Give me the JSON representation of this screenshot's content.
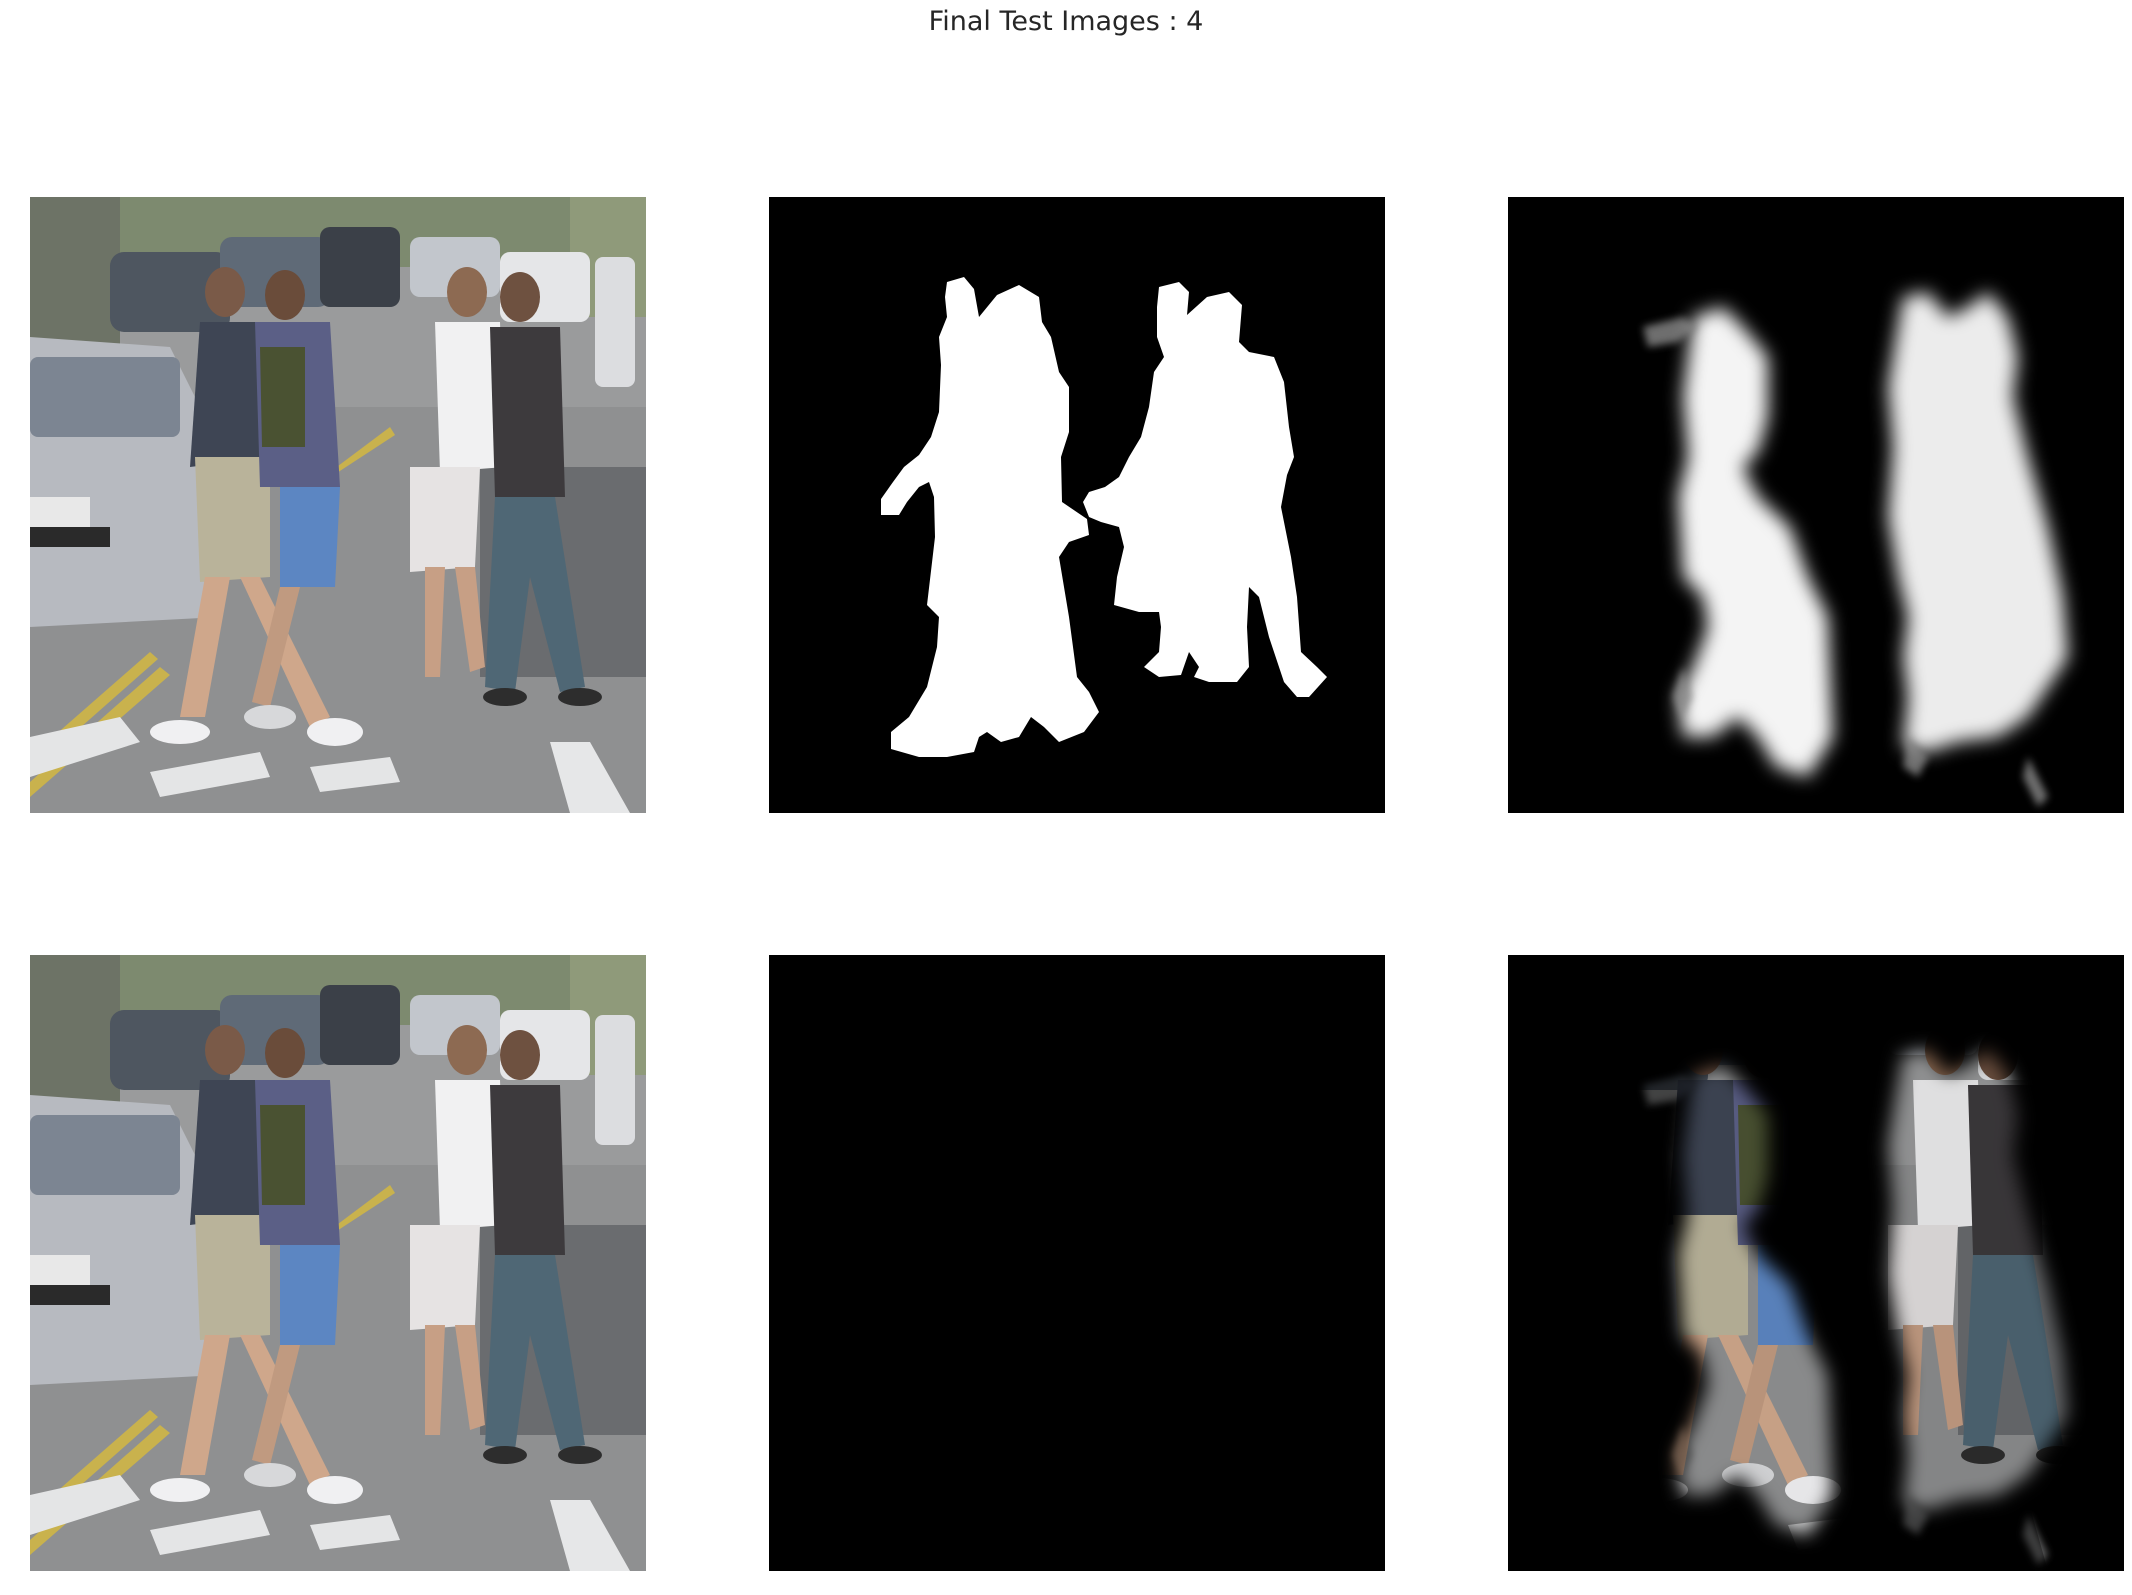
{
  "figure": {
    "title": "Final Test Images : 4"
  },
  "panels": [
    {
      "row": 1,
      "col": 1,
      "content": "original street photo"
    },
    {
      "row": 1,
      "col": 2,
      "content": "ground truth mask"
    },
    {
      "row": 1,
      "col": 3,
      "content": "predicted mask"
    },
    {
      "row": 2,
      "col": 1,
      "content": "original street photo"
    },
    {
      "row": 2,
      "col": 2,
      "content": "ground truth masked image"
    },
    {
      "row": 2,
      "col": 3,
      "content": "predicted masked image"
    }
  ]
}
